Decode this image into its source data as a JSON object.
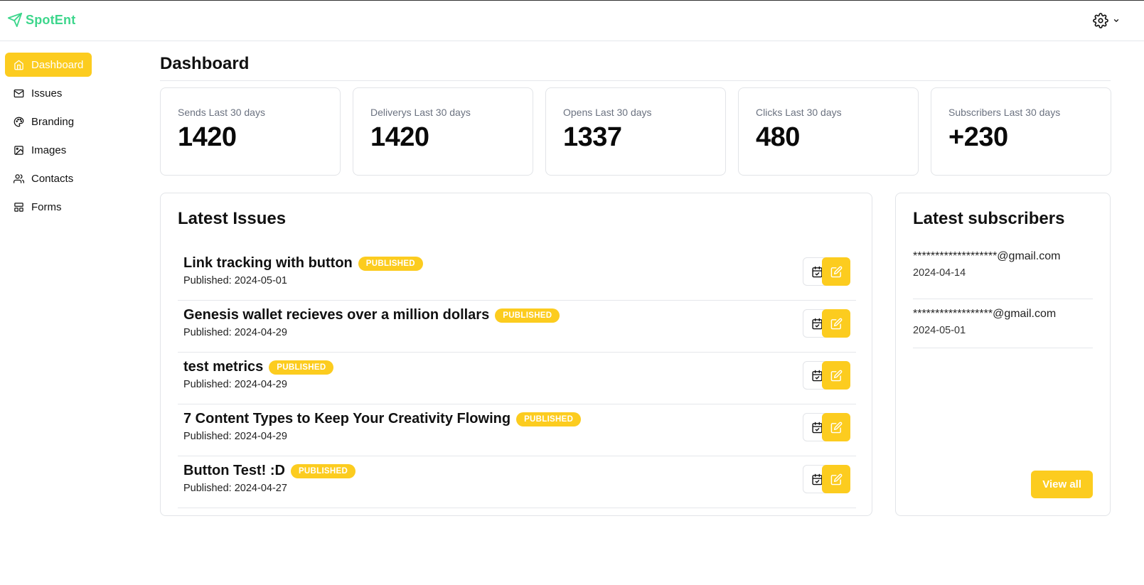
{
  "app": {
    "brand": "SpotEnt"
  },
  "header": {
    "settings_icon": "gear-icon"
  },
  "sidebar": {
    "items": [
      {
        "label": "Dashboard",
        "icon": "home-icon",
        "active": true
      },
      {
        "label": "Issues",
        "icon": "mail-icon"
      },
      {
        "label": "Branding",
        "icon": "palette-icon"
      },
      {
        "label": "Images",
        "icon": "image-icon"
      },
      {
        "label": "Contacts",
        "icon": "users-icon"
      },
      {
        "label": "Forms",
        "icon": "layout-icon"
      }
    ]
  },
  "main": {
    "title": "Dashboard",
    "stats": [
      {
        "label": "Sends Last 30 days",
        "value": "1420"
      },
      {
        "label": "Deliverys Last 30 days",
        "value": "1420"
      },
      {
        "label": "Opens Last 30 days",
        "value": "1337"
      },
      {
        "label": "Clicks Last 30 days",
        "value": "480"
      },
      {
        "label": "Subscribers Last 30 days",
        "value": "+230"
      }
    ],
    "latest_issues": {
      "title": "Latest Issues",
      "items": [
        {
          "title": "Link tracking with button",
          "status": "PUBLISHED",
          "date": "Published: 2024-05-01"
        },
        {
          "title": "Genesis wallet recieves over a million dollars",
          "status": "PUBLISHED",
          "date": "Published: 2024-04-29"
        },
        {
          "title": "test metrics",
          "status": "PUBLISHED",
          "date": "Published: 2024-04-29"
        },
        {
          "title": "7 Content Types to Keep Your Creativity Flowing",
          "status": "PUBLISHED",
          "date": "Published: 2024-04-29"
        },
        {
          "title": "Button Test! :D",
          "status": "PUBLISHED",
          "date": "Published: 2024-04-27"
        }
      ]
    },
    "latest_subscribers": {
      "title": "Latest subscribers",
      "items": [
        {
          "email": "*******************@gmail.com",
          "date": "2024-04-14"
        },
        {
          "email": "******************@gmail.com",
          "date": "2024-05-01"
        }
      ],
      "view_all_label": "View all"
    }
  },
  "colors": {
    "accent": "#fccc1f",
    "brand": "#3dd68c",
    "border": "#e2e4e8"
  }
}
